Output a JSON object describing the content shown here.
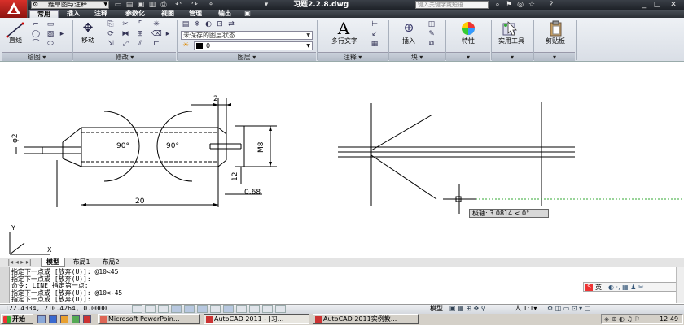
{
  "titlebar": {
    "workspace": "二维草图与注释",
    "doc_title": "习题2.2.8.dwg",
    "search_placeholder": "键入关键字或短语",
    "icons": [
      "new-icon",
      "open-icon",
      "save-icon",
      "undo-icon",
      "redo-icon",
      "print-icon",
      "help-icon",
      "close-icon",
      "minimize-icon",
      "maximize-icon"
    ]
  },
  "tabs": [
    "常用",
    "插入",
    "注释",
    "参数化",
    "视图",
    "管理",
    "输出"
  ],
  "active_tab": "常用",
  "ribbon": {
    "panels": [
      {
        "title": "绘图",
        "main": "直线"
      },
      {
        "title": "修改",
        "main": "移动"
      },
      {
        "title": "图层"
      },
      {
        "title": "注释",
        "main": "多行文字"
      },
      {
        "title": "块",
        "main": "插入"
      },
      {
        "title": "",
        "main": "特性"
      },
      {
        "title": "",
        "main": "实用工具"
      },
      {
        "title": "",
        "main": "剪贴板"
      }
    ],
    "layer_state": "未保存的图层状态",
    "current_layer": "0"
  },
  "drawing": {
    "dims": {
      "top_width": "2",
      "left_diameter": "φ2",
      "angle_left": "90°",
      "angle_right": "90°",
      "thread": "M8",
      "small_dim": "12",
      "chamfer": "0.68",
      "length": "20"
    },
    "ucs_y": "Y",
    "ucs_x": "X",
    "tooltip": "极轴: 3.0814 < 0°"
  },
  "layout_tabs": [
    "模型",
    "布局1",
    "布局2"
  ],
  "active_layout": "模型",
  "command_lines": [
    "指定下一点或 [放弃(U)]: @10<45",
    "指定下一点或 [放弃(U)]:",
    "命令: LINE 指定第一点:",
    "指定下一点或 [放弃(U)]: @10<-45",
    "指定下一点或 [放弃(U)]:"
  ],
  "status": {
    "coords": "122.4334, 210.4264, 0.0000",
    "model_label": "模型",
    "scale": "1:1"
  },
  "taskbar": {
    "start": "开始",
    "tasks": [
      "Microsoft PowerPoin...",
      "AutoCAD 2011 - [习...",
      "AutoCAD 2011实例教..."
    ],
    "clock": "12:49",
    "ime": "英"
  }
}
